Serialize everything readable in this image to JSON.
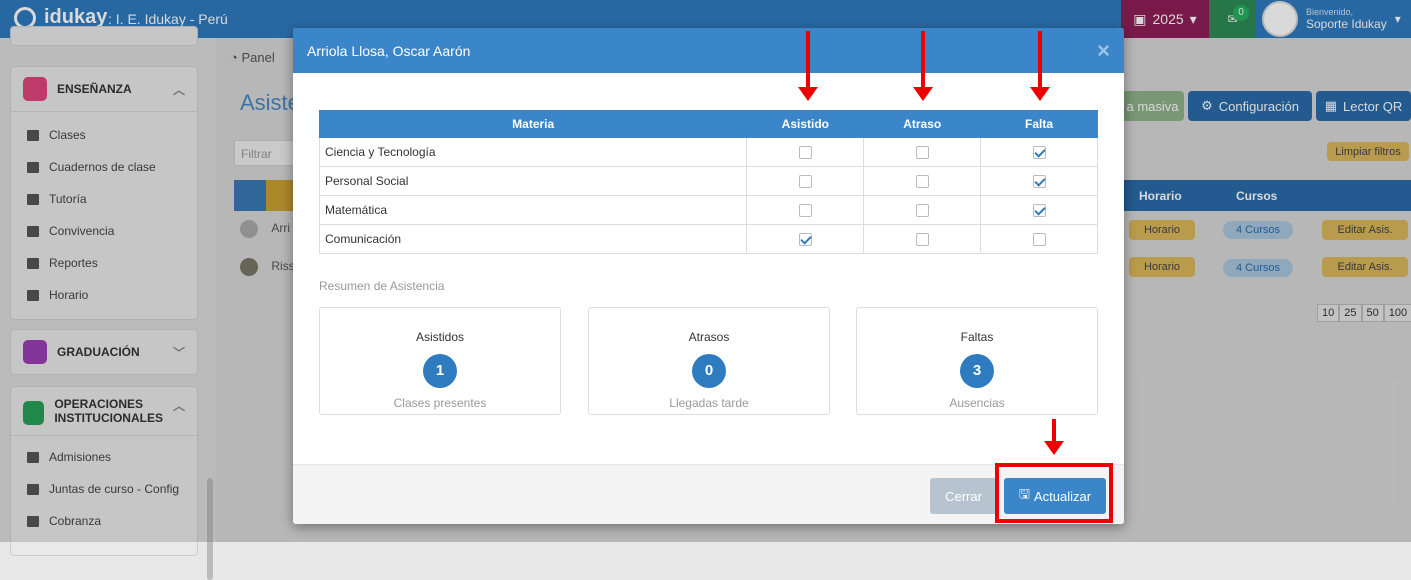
{
  "topbar": {
    "logo": "idukay",
    "school": ": I. E. Idukay - Perú",
    "year": "2025",
    "mail_count": "0",
    "welcome": "Bienvenido,",
    "user": "Soporte Idukay"
  },
  "sidebar": {
    "ensenanza": {
      "title": "ENSEÑANZA",
      "items": [
        "Clases",
        "Cuadernos de clase",
        "Tutoría",
        "Convivencia",
        "Reportes",
        "Horario"
      ]
    },
    "graduacion": {
      "title": "GRADUACIÓN"
    },
    "operaciones": {
      "title": "OPERACIONES INSTITUCIONALES",
      "items": [
        "Admisiones",
        "Juntas de curso - Config",
        "Cobranza"
      ]
    }
  },
  "background": {
    "breadcrumb": "Panel",
    "page_title": "Asiste",
    "filter_placeholder": "Filtrar",
    "masiva": "a masiva",
    "config": "Configuración",
    "lector": "Lector QR",
    "limpiar": "Limpiar filtros",
    "col_horario": "Horario",
    "col_cursos": "Cursos",
    "rows": [
      {
        "name": "Arri",
        "horario": "Horario",
        "cursos": "4 Cursos",
        "editar": "Editar Asis."
      },
      {
        "name": "Riss",
        "horario": "Horario",
        "cursos": "4 Cursos",
        "editar": "Editar Asis."
      }
    ],
    "pagination": [
      "10",
      "25",
      "50",
      "100"
    ]
  },
  "modal": {
    "title": "Arriola Llosa, Oscar Aarón",
    "close": "×",
    "headers": [
      "Materia",
      "Asistido",
      "Atraso",
      "Falta"
    ],
    "rows": [
      {
        "materia": "Ciencia y Tecnología",
        "asistido": false,
        "atraso": false,
        "falta": true
      },
      {
        "materia": "Personal Social",
        "asistido": false,
        "atraso": false,
        "falta": true
      },
      {
        "materia": "Matemática",
        "asistido": false,
        "atraso": false,
        "falta": true
      },
      {
        "materia": "Comunicación",
        "asistido": true,
        "atraso": false,
        "falta": false
      }
    ],
    "summary_label": "Resumen de Asistencia",
    "cards": [
      {
        "title": "Asistidos",
        "value": "1",
        "sub": "Clases presentes"
      },
      {
        "title": "Atrasos",
        "value": "0",
        "sub": "Llegadas tarde"
      },
      {
        "title": "Faltas",
        "value": "3",
        "sub": "Ausencias"
      }
    ],
    "cerrar": "Cerrar",
    "actualizar": "Actualizar"
  },
  "colors": {
    "primary": "#3a86c9",
    "annotation": "#ee0000"
  }
}
